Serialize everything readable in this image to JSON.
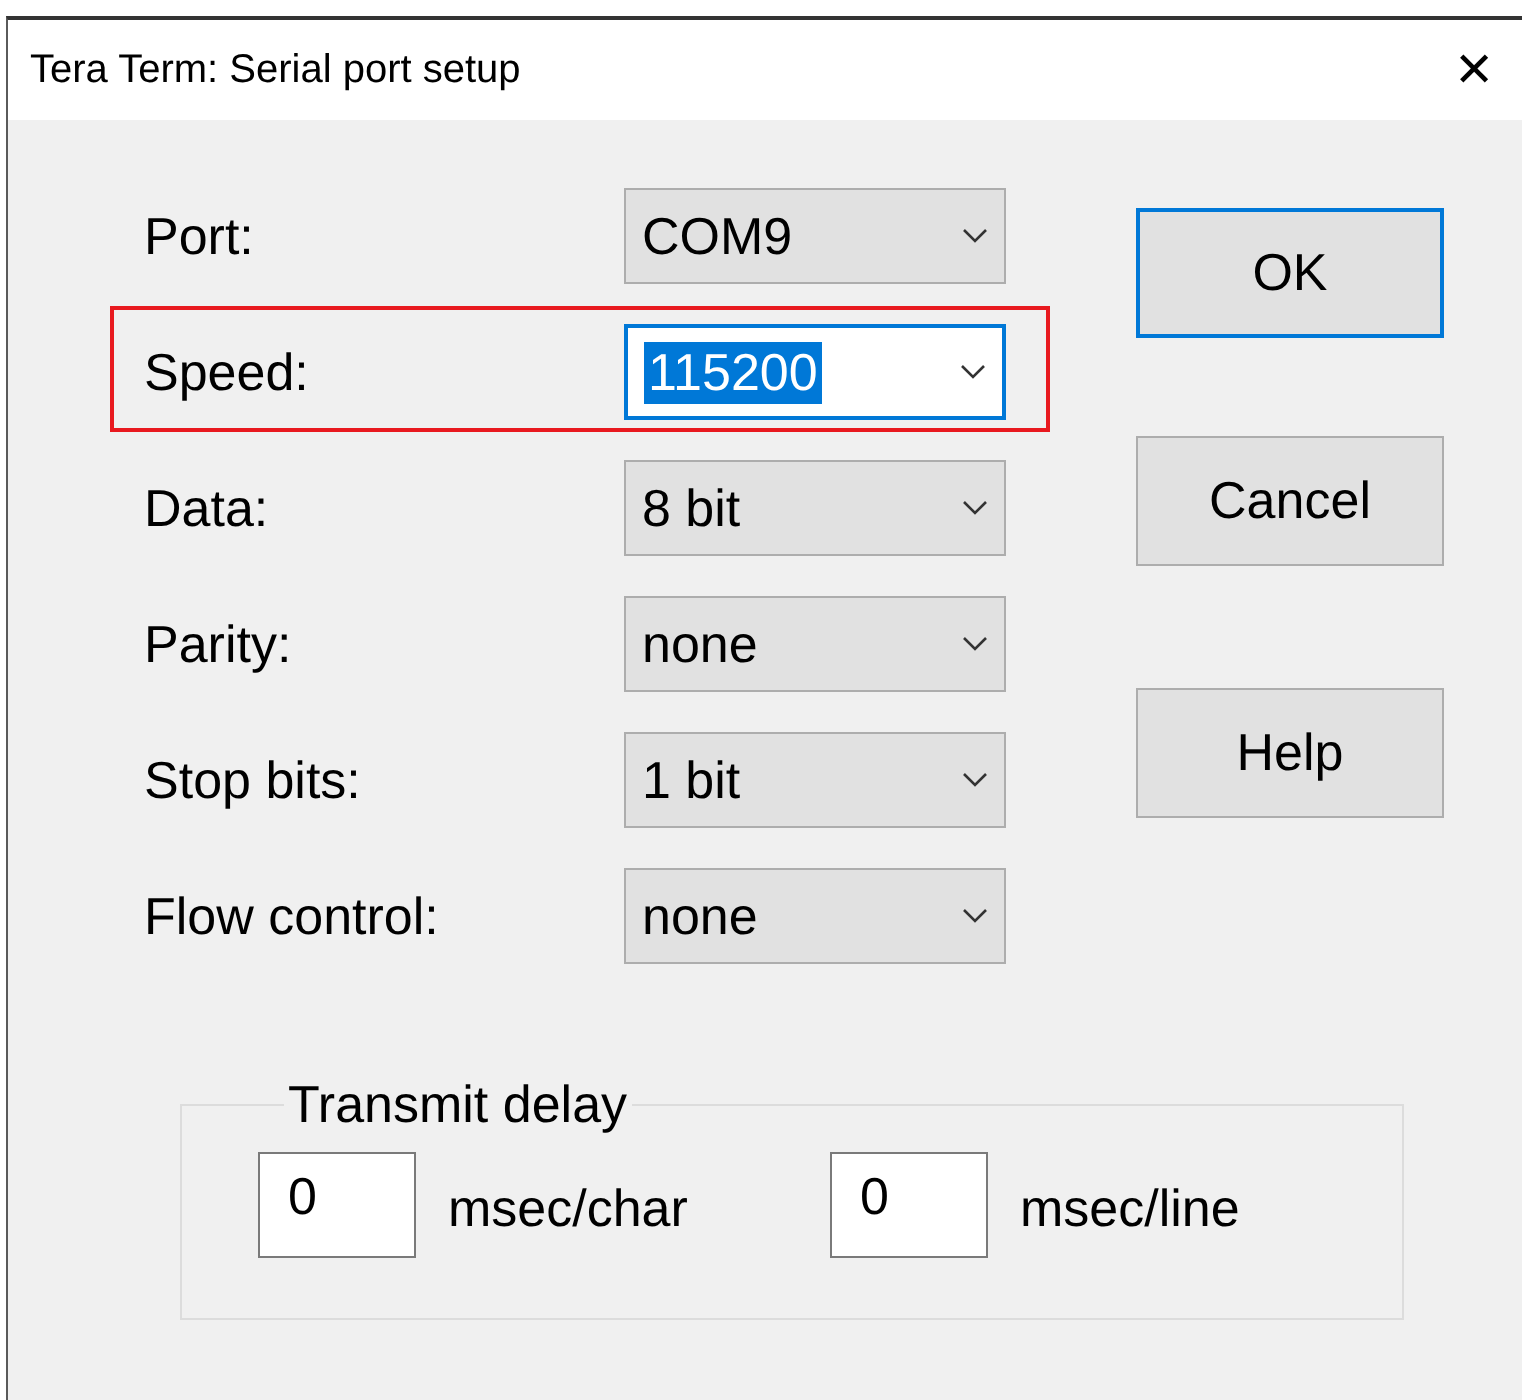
{
  "window": {
    "title": "Tera Term: Serial port setup",
    "close": "✕"
  },
  "settings": [
    {
      "label": "Port:",
      "value": "COM9",
      "focused": false,
      "highlighted": false
    },
    {
      "label": "Speed:",
      "value": "115200",
      "focused": true,
      "highlighted": true
    },
    {
      "label": "Data:",
      "value": "8 bit",
      "focused": false,
      "highlighted": false
    },
    {
      "label": "Parity:",
      "value": "none",
      "focused": false,
      "highlighted": false
    },
    {
      "label": "Stop bits:",
      "value": "1 bit",
      "focused": false,
      "highlighted": false
    },
    {
      "label": "Flow control:",
      "value": "none",
      "focused": false,
      "highlighted": false
    }
  ],
  "buttons": [
    {
      "label": "OK",
      "default": true
    },
    {
      "label": "Cancel",
      "default": false
    },
    {
      "label": "Help",
      "default": false
    }
  ],
  "transmit_delay": {
    "title": "Transmit delay",
    "fields": [
      {
        "value": "0",
        "unit": "msec/char"
      },
      {
        "value": "0",
        "unit": "msec/line"
      }
    ]
  }
}
